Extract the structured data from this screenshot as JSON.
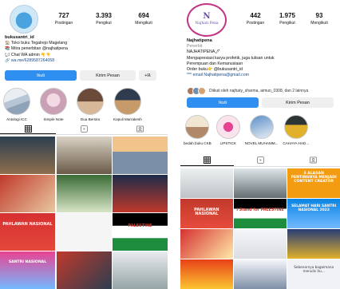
{
  "left_profile": {
    "username": "bukusantri_id",
    "stats": [
      {
        "value": "727",
        "label": "Postingan"
      },
      {
        "value": "3.393",
        "label": "Pengikut"
      },
      {
        "value": "694",
        "label": "Mengikuti"
      }
    ],
    "bio_lines": [
      "bukusantri_id",
      "🏠 Toko buku Tegalrejo Magelang",
      "📚 Mitra penerbitan @najhatipena",
      "💬 Chat WA admin 👇👇",
      "🔗 wa.me/6289587264058"
    ],
    "buttons": {
      "primary": "Ikuti",
      "secondary": "Kirim Pesan",
      "icon": "+ℝ"
    },
    "highlights": [
      "Antologi ICC",
      "Simple Note",
      "Dua Bersira",
      "Kopuli Marrakesh"
    ],
    "grid_texts": [
      "",
      "",
      "",
      "",
      "",
      "",
      "PAHLAWAN NASIONAL",
      "",
      "PALESTINE",
      "SANTRI NASIONAL",
      "",
      ""
    ]
  },
  "right_profile": {
    "logo_text": "Najhati Pena",
    "stats": [
      {
        "value": "442",
        "label": "Postingan"
      },
      {
        "value": "1.975",
        "label": "Pengikut"
      },
      {
        "value": "93",
        "label": "Mengikuti"
      }
    ],
    "bio_lines": [
      "Najhatipena",
      "Penerbit",
      "NAJHATIPENA🖊",
      "Mengapresiasi karya profetik, juga tulisan untuk",
      "Perempuan dan Kemanusiaan",
      "Order buku👉 @bukusantri_id",
      "*** email Najhatipena@gmail.com"
    ],
    "followed_by": "Diikuti oleh najhaty_sharma, aimun_0308, dan 2 lainnya",
    "buttons": {
      "primary": "Ikuti",
      "secondary": "Kirim Pesan"
    },
    "highlights": [
      "bedah buku CKB",
      "LIPSTICK",
      "NOVEL MUHAMM...",
      "CAHAYA HAD..."
    ],
    "grid_texts": [
      "",
      "",
      "3 ALASAN PENTINGNYA MENJADI CONTENT CREATOR",
      "PAHLAWAN NASIONAL",
      "I Stand for PALESTINE",
      "SELAMAT HARI SANTRI NASIONAL 2023",
      "",
      "",
      "",
      "",
      "",
      "Sebenarnya bagaimana menulis itu..."
    ]
  },
  "colors": {
    "accent_blue": "#2e8ff0",
    "ring_pink": "#c13584"
  }
}
